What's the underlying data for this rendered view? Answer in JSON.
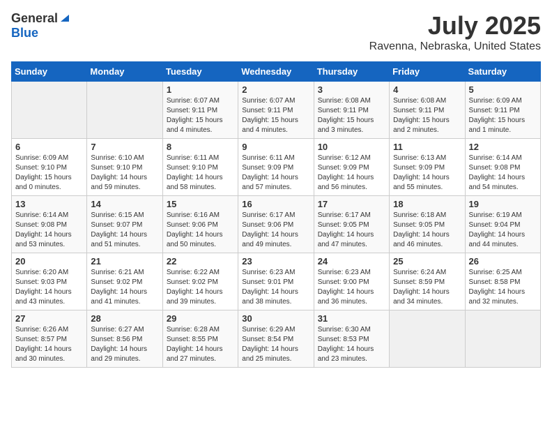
{
  "header": {
    "logo_general": "General",
    "logo_blue": "Blue",
    "title": "July 2025",
    "subtitle": "Ravenna, Nebraska, United States"
  },
  "weekdays": [
    "Sunday",
    "Monday",
    "Tuesday",
    "Wednesday",
    "Thursday",
    "Friday",
    "Saturday"
  ],
  "weeks": [
    [
      {
        "day": "",
        "content": ""
      },
      {
        "day": "",
        "content": ""
      },
      {
        "day": "1",
        "content": "Sunrise: 6:07 AM\nSunset: 9:11 PM\nDaylight: 15 hours\nand 4 minutes."
      },
      {
        "day": "2",
        "content": "Sunrise: 6:07 AM\nSunset: 9:11 PM\nDaylight: 15 hours\nand 4 minutes."
      },
      {
        "day": "3",
        "content": "Sunrise: 6:08 AM\nSunset: 9:11 PM\nDaylight: 15 hours\nand 3 minutes."
      },
      {
        "day": "4",
        "content": "Sunrise: 6:08 AM\nSunset: 9:11 PM\nDaylight: 15 hours\nand 2 minutes."
      },
      {
        "day": "5",
        "content": "Sunrise: 6:09 AM\nSunset: 9:11 PM\nDaylight: 15 hours\nand 1 minute."
      }
    ],
    [
      {
        "day": "6",
        "content": "Sunrise: 6:09 AM\nSunset: 9:10 PM\nDaylight: 15 hours\nand 0 minutes."
      },
      {
        "day": "7",
        "content": "Sunrise: 6:10 AM\nSunset: 9:10 PM\nDaylight: 14 hours\nand 59 minutes."
      },
      {
        "day": "8",
        "content": "Sunrise: 6:11 AM\nSunset: 9:10 PM\nDaylight: 14 hours\nand 58 minutes."
      },
      {
        "day": "9",
        "content": "Sunrise: 6:11 AM\nSunset: 9:09 PM\nDaylight: 14 hours\nand 57 minutes."
      },
      {
        "day": "10",
        "content": "Sunrise: 6:12 AM\nSunset: 9:09 PM\nDaylight: 14 hours\nand 56 minutes."
      },
      {
        "day": "11",
        "content": "Sunrise: 6:13 AM\nSunset: 9:09 PM\nDaylight: 14 hours\nand 55 minutes."
      },
      {
        "day": "12",
        "content": "Sunrise: 6:14 AM\nSunset: 9:08 PM\nDaylight: 14 hours\nand 54 minutes."
      }
    ],
    [
      {
        "day": "13",
        "content": "Sunrise: 6:14 AM\nSunset: 9:08 PM\nDaylight: 14 hours\nand 53 minutes."
      },
      {
        "day": "14",
        "content": "Sunrise: 6:15 AM\nSunset: 9:07 PM\nDaylight: 14 hours\nand 51 minutes."
      },
      {
        "day": "15",
        "content": "Sunrise: 6:16 AM\nSunset: 9:06 PM\nDaylight: 14 hours\nand 50 minutes."
      },
      {
        "day": "16",
        "content": "Sunrise: 6:17 AM\nSunset: 9:06 PM\nDaylight: 14 hours\nand 49 minutes."
      },
      {
        "day": "17",
        "content": "Sunrise: 6:17 AM\nSunset: 9:05 PM\nDaylight: 14 hours\nand 47 minutes."
      },
      {
        "day": "18",
        "content": "Sunrise: 6:18 AM\nSunset: 9:05 PM\nDaylight: 14 hours\nand 46 minutes."
      },
      {
        "day": "19",
        "content": "Sunrise: 6:19 AM\nSunset: 9:04 PM\nDaylight: 14 hours\nand 44 minutes."
      }
    ],
    [
      {
        "day": "20",
        "content": "Sunrise: 6:20 AM\nSunset: 9:03 PM\nDaylight: 14 hours\nand 43 minutes."
      },
      {
        "day": "21",
        "content": "Sunrise: 6:21 AM\nSunset: 9:02 PM\nDaylight: 14 hours\nand 41 minutes."
      },
      {
        "day": "22",
        "content": "Sunrise: 6:22 AM\nSunset: 9:02 PM\nDaylight: 14 hours\nand 39 minutes."
      },
      {
        "day": "23",
        "content": "Sunrise: 6:23 AM\nSunset: 9:01 PM\nDaylight: 14 hours\nand 38 minutes."
      },
      {
        "day": "24",
        "content": "Sunrise: 6:23 AM\nSunset: 9:00 PM\nDaylight: 14 hours\nand 36 minutes."
      },
      {
        "day": "25",
        "content": "Sunrise: 6:24 AM\nSunset: 8:59 PM\nDaylight: 14 hours\nand 34 minutes."
      },
      {
        "day": "26",
        "content": "Sunrise: 6:25 AM\nSunset: 8:58 PM\nDaylight: 14 hours\nand 32 minutes."
      }
    ],
    [
      {
        "day": "27",
        "content": "Sunrise: 6:26 AM\nSunset: 8:57 PM\nDaylight: 14 hours\nand 30 minutes."
      },
      {
        "day": "28",
        "content": "Sunrise: 6:27 AM\nSunset: 8:56 PM\nDaylight: 14 hours\nand 29 minutes."
      },
      {
        "day": "29",
        "content": "Sunrise: 6:28 AM\nSunset: 8:55 PM\nDaylight: 14 hours\nand 27 minutes."
      },
      {
        "day": "30",
        "content": "Sunrise: 6:29 AM\nSunset: 8:54 PM\nDaylight: 14 hours\nand 25 minutes."
      },
      {
        "day": "31",
        "content": "Sunrise: 6:30 AM\nSunset: 8:53 PM\nDaylight: 14 hours\nand 23 minutes."
      },
      {
        "day": "",
        "content": ""
      },
      {
        "day": "",
        "content": ""
      }
    ]
  ]
}
